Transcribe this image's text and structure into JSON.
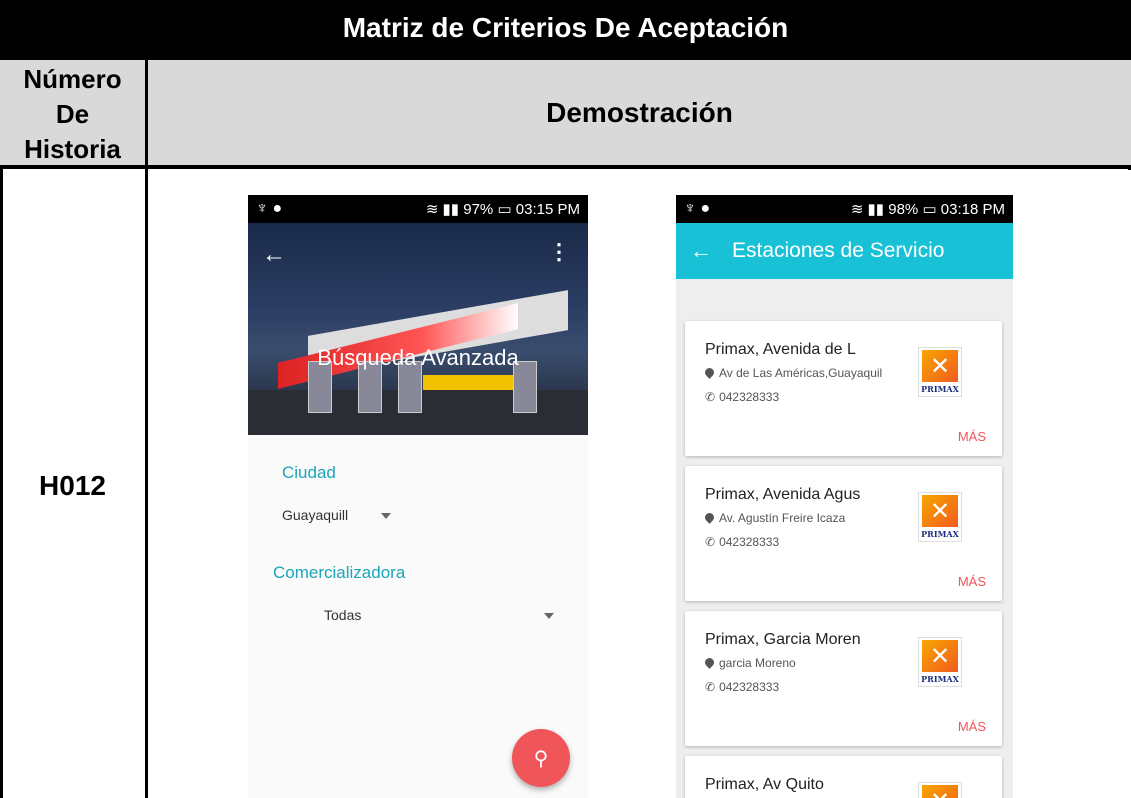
{
  "document": {
    "title": "Matriz de Criterios De Aceptación",
    "header_number": "Número De Historia",
    "header_demo": "Demostración",
    "story_id": "H012"
  },
  "screen1": {
    "status_time": "03:15 PM",
    "status_battery": "97%",
    "hero_title": "Búsqueda Avanzada",
    "city_label": "Ciudad",
    "city_value": "Guayaquill",
    "company_label": "Comercializadora",
    "company_value": "Todas"
  },
  "screen2": {
    "status_time": "03:18 PM",
    "status_battery": "98%",
    "title": "Estaciones de Servicio",
    "more_label": "MÁS",
    "logo_text": "PRIMAX",
    "stations": [
      {
        "name": "Primax, Avenida de L",
        "address": "Av de Las Américas,Guayaquil",
        "phone": "042328333"
      },
      {
        "name": "Primax, Avenida Agus",
        "address": "Av. Agustín Freire Icaza",
        "phone": "042328333"
      },
      {
        "name": "Primax, Garcia Moren",
        "address": "garcia Moreno",
        "phone": "042328333"
      },
      {
        "name": "Primax, Av Quito",
        "address": "",
        "phone": ""
      }
    ]
  }
}
